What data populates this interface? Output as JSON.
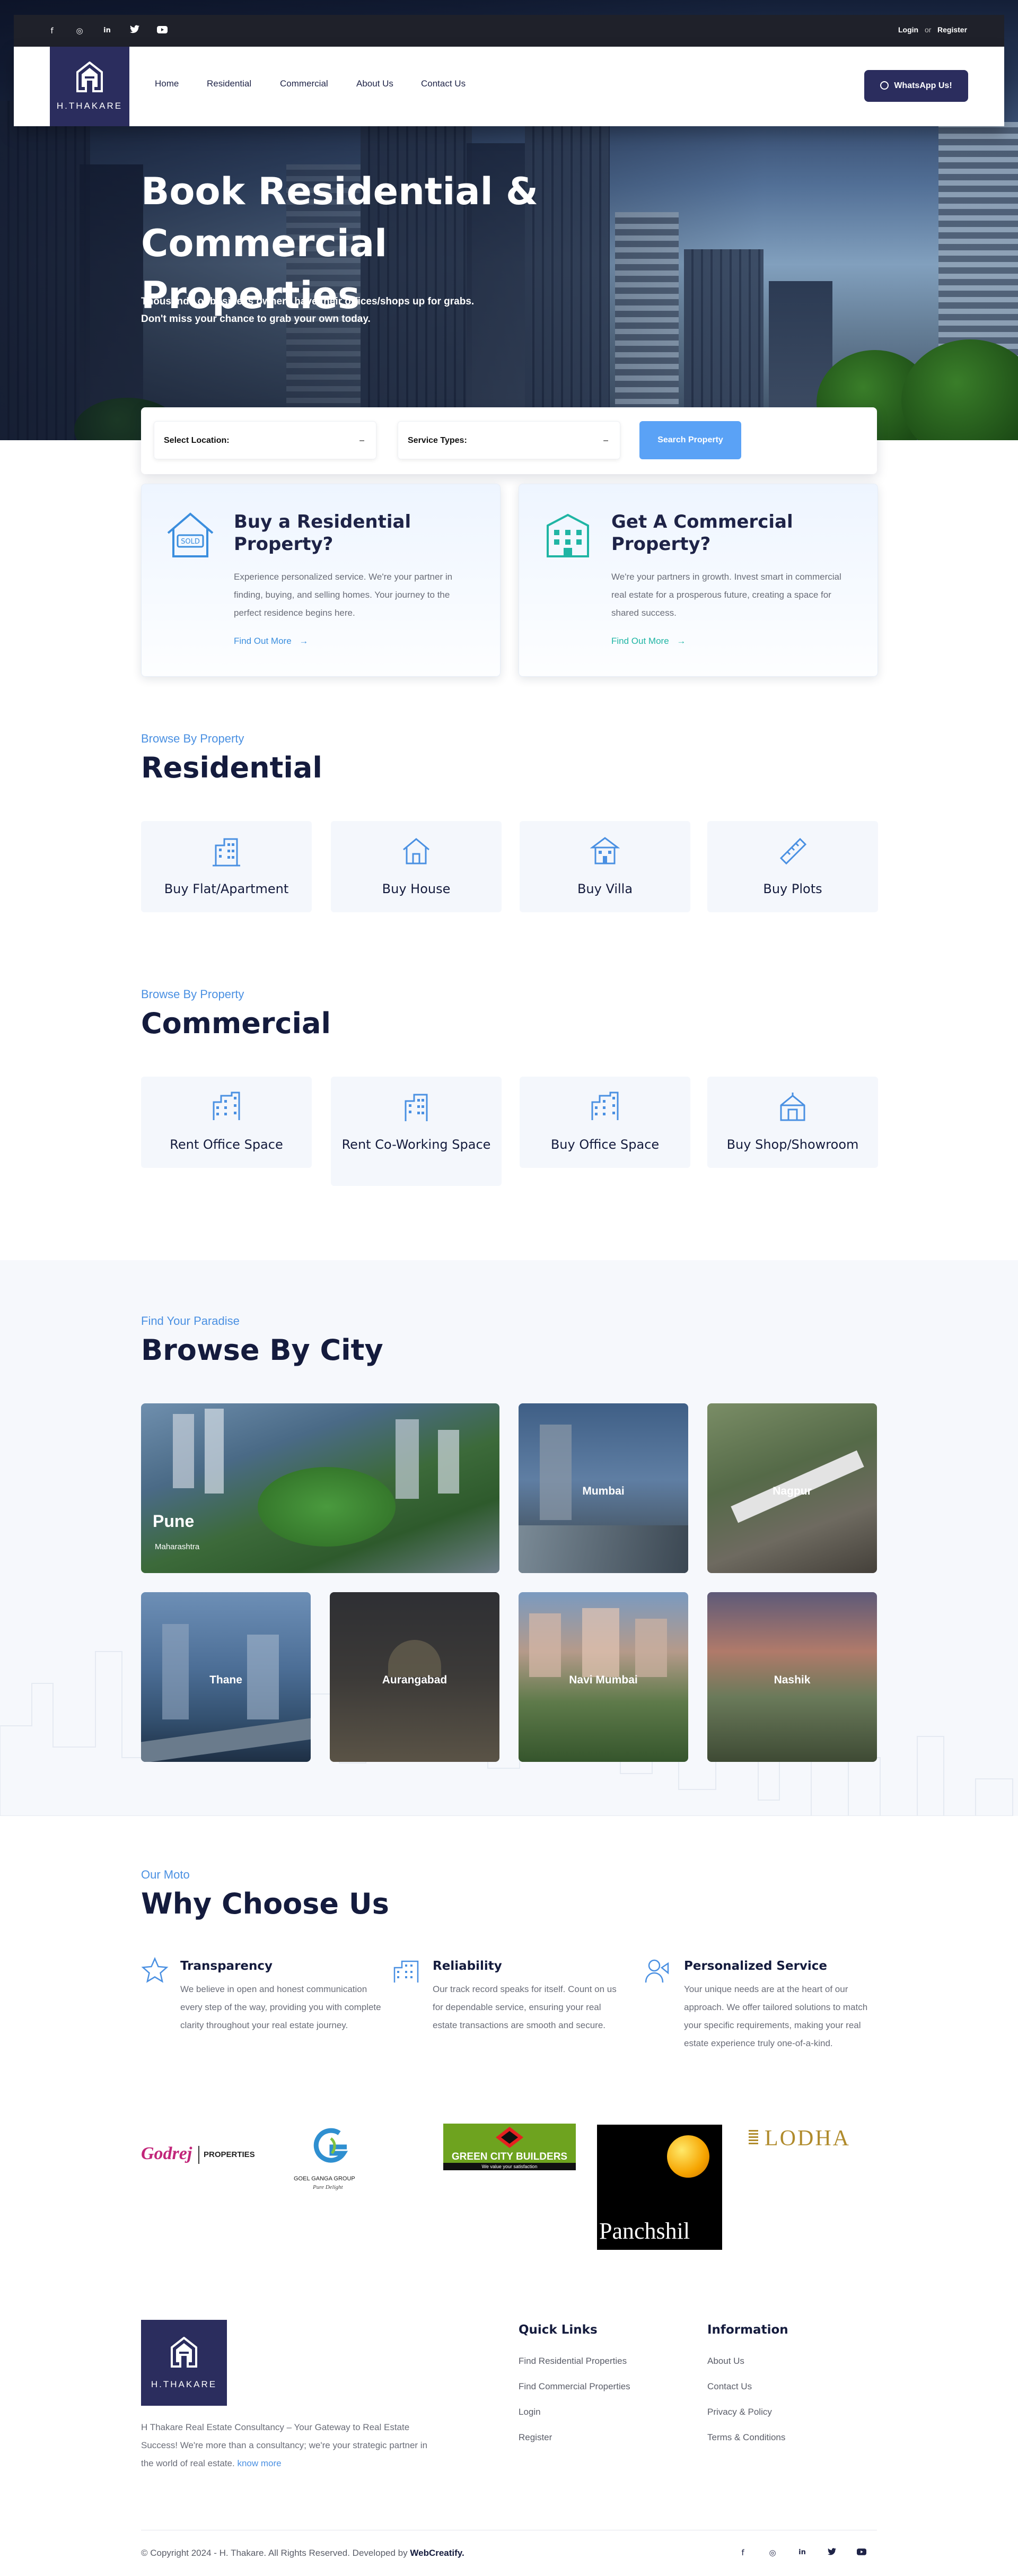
{
  "header": {
    "social": [
      "f",
      "◎",
      "in",
      "🐦",
      "▶"
    ],
    "social_names": [
      "facebook-icon",
      "instagram-icon",
      "linkedin-icon",
      "twitter-icon",
      "youtube-icon"
    ],
    "login": "Login",
    "or": "or",
    "register": "Register",
    "logo_text": "H.THAKARE",
    "nav": [
      "Home",
      "Residential",
      "Commercial",
      "About Us",
      "Contact Us"
    ],
    "whatsapp": "WhatsApp Us!"
  },
  "hero": {
    "title_line1": "Book Residential &",
    "title_line2": "Commercial Properties",
    "sub_line1": "Thousands of business owners have their offices/shops up for grabs.",
    "sub_line2": "Don't miss your chance to grab your own today."
  },
  "search": {
    "location": "Select Location:",
    "service": "Service Types:",
    "button": "Search Property",
    "caret": "–"
  },
  "promo": [
    {
      "title": "Buy a Residential Property?",
      "text": "Experience personalized service. We're your partner in finding, buying, and selling homes. Your journey to the perfect residence begins here.",
      "link": "Find Out More",
      "color": "#3b8ede"
    },
    {
      "title": "Get A Commercial Property?",
      "text": "We're your partners in growth. Invest smart in commercial real estate for a prosperous future, creating a space for shared success.",
      "link": "Find Out More",
      "color": "#1fb5a4"
    }
  ],
  "residential": {
    "eyebrow": "Browse By Property",
    "title": "Residential",
    "items": [
      "Buy Flat/Apartment",
      "Buy House",
      "Buy Villa",
      "Buy Plots"
    ]
  },
  "commercial": {
    "eyebrow": "Browse By Property",
    "title": "Commercial",
    "items": [
      "Rent Office Space",
      "Rent Co-Working Space",
      "Buy Office Space",
      "Buy Shop/Showroom"
    ]
  },
  "city": {
    "eyebrow": "Find Your Paradise",
    "title": "Browse By City",
    "featured": {
      "name": "Pune",
      "state": "Maharashtra"
    },
    "cities": [
      "Mumbai",
      "Nagpur",
      "Thane",
      "Aurangabad",
      "Navi Mumbai",
      "Nashik"
    ]
  },
  "why": {
    "eyebrow": "Our Moto",
    "title": "Why Choose Us",
    "items": [
      {
        "title": "Transparency",
        "text": "We believe in open and honest communication every step of the way, providing you with complete clarity throughout your real estate journey."
      },
      {
        "title": "Reliability",
        "text": "Our track record speaks for itself. Count on us for dependable service, ensuring your real estate transactions are smooth and secure."
      },
      {
        "title": "Personalized Service",
        "text": "Your unique needs are at the heart of our approach. We offer tailored solutions to match your specific requirements, making your real estate experience truly one-of-a-kind."
      }
    ]
  },
  "partners": {
    "godrej": "Godrej",
    "godrej_sub": "PROPERTIES",
    "goel": "GOEL GANGA GROUP",
    "goel_tag": "Pure Delight",
    "gcb": "GREEN CITY BUILDERS",
    "gcb_tag": "We value your satisfaction",
    "panchshil": "Panchshil",
    "lodha": "LODHA"
  },
  "footer": {
    "about": "H Thakare Real Estate Consultancy – Your Gateway to Real Estate Success! We're more than a consultancy; we're your strategic partner in the world of real estate.",
    "know_more": "know more",
    "quick_title": "Quick Links",
    "quick": [
      "Find Residential Properties",
      "Find Commercial Properties",
      "Login",
      "Register"
    ],
    "info_title": "Information",
    "info": [
      "About Us",
      "Contact Us",
      "Privacy & Policy",
      "Terms & Conditions"
    ],
    "copyright": "© Copyright 2024 - H. Thakare. All Rights Reserved. Developed by",
    "developer": "WebCreatify."
  },
  "colors": {
    "navy": "#2b2d5e",
    "accent": "#4a90e2",
    "button": "#5aa2f6",
    "teal": "#1fb5a4"
  }
}
